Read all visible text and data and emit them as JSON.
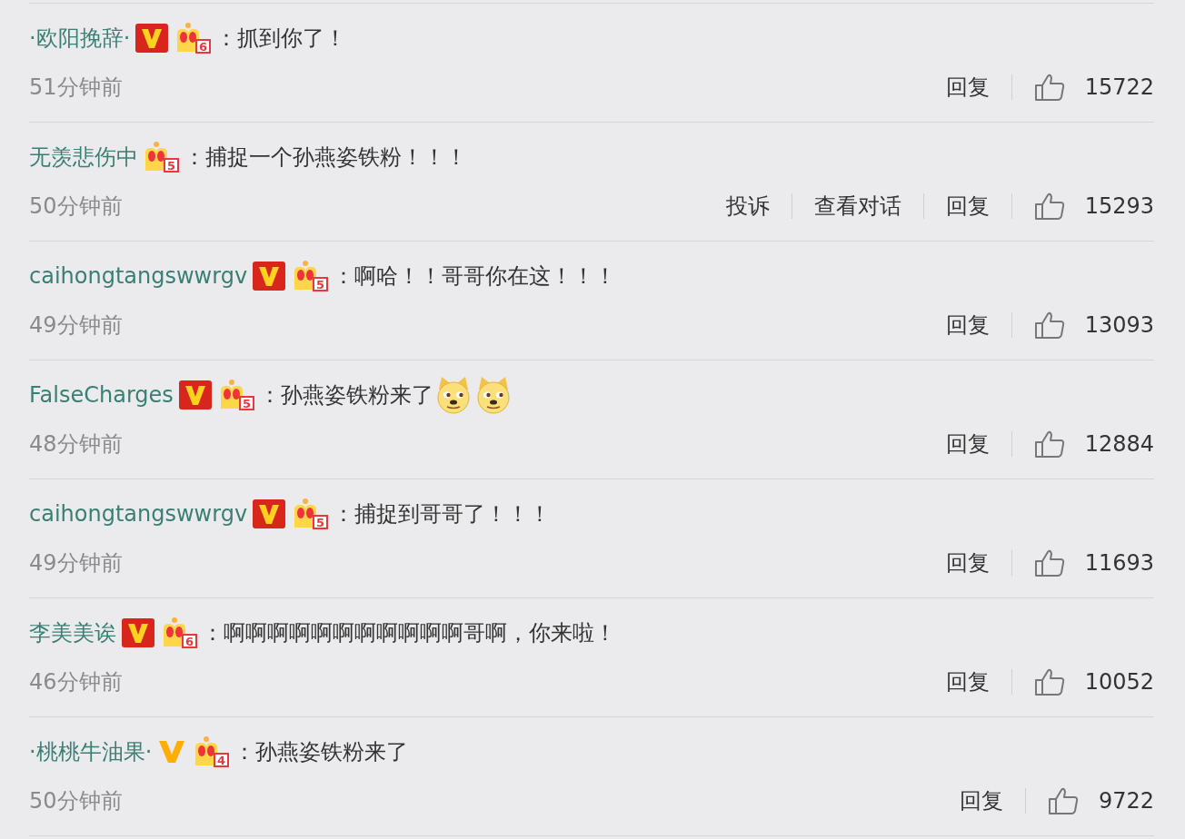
{
  "comments": [
    {
      "user": "·欧阳挽辞·",
      "v_badge": {
        "color": "#d8261c"
      },
      "vip_rank": "6",
      "text": "：抓到你了！",
      "time": "51分钟前",
      "actions": [
        "回复"
      ],
      "likes": "15722"
    },
    {
      "user": "无羡悲伤中",
      "vip_rank": "5",
      "text": "：捕捉一个孙燕姿铁粉！！！",
      "time": "50分钟前",
      "actions": [
        "投诉",
        "查看对话",
        "回复"
      ],
      "likes": "15293"
    },
    {
      "user": "caihongtangswwrgv",
      "v_badge": {
        "color": "#d8261c"
      },
      "vip_rank": "5",
      "text": "：啊哈！！哥哥你在这！！！",
      "time": "49分钟前",
      "actions": [
        "回复"
      ],
      "likes": "13093"
    },
    {
      "user": "FalseCharges",
      "v_badge": {
        "color": "#d8261c"
      },
      "vip_rank": "5",
      "text": "：孙燕姿铁粉来了",
      "emojis": [
        {
          "kind": "doge"
        },
        {
          "kind": "doge"
        }
      ],
      "time": "48分钟前",
      "actions": [
        "回复"
      ],
      "likes": "12884"
    },
    {
      "user": "caihongtangswwrgv",
      "v_badge": {
        "color": "#d8261c"
      },
      "vip_rank": "5",
      "text": "：捕捉到哥哥了！！！",
      "time": "49分钟前",
      "actions": [
        "回复"
      ],
      "likes": "11693"
    },
    {
      "user": "李美美诶",
      "v_badge": {
        "color": "#d8261c"
      },
      "vip_rank": "6",
      "text": "：啊啊啊啊啊啊啊啊啊啊啊哥啊，你来啦！",
      "time": "46分钟前",
      "actions": [
        "回复"
      ],
      "likes": "10052"
    },
    {
      "user": "·桃桃牛油果·",
      "v_badge": {
        "color": "#ffae00"
      },
      "vip_rank": "4",
      "text": "：孙燕姿铁粉来了",
      "time": "50分钟前",
      "actions": [
        "回复"
      ],
      "likes": "9722"
    }
  ]
}
